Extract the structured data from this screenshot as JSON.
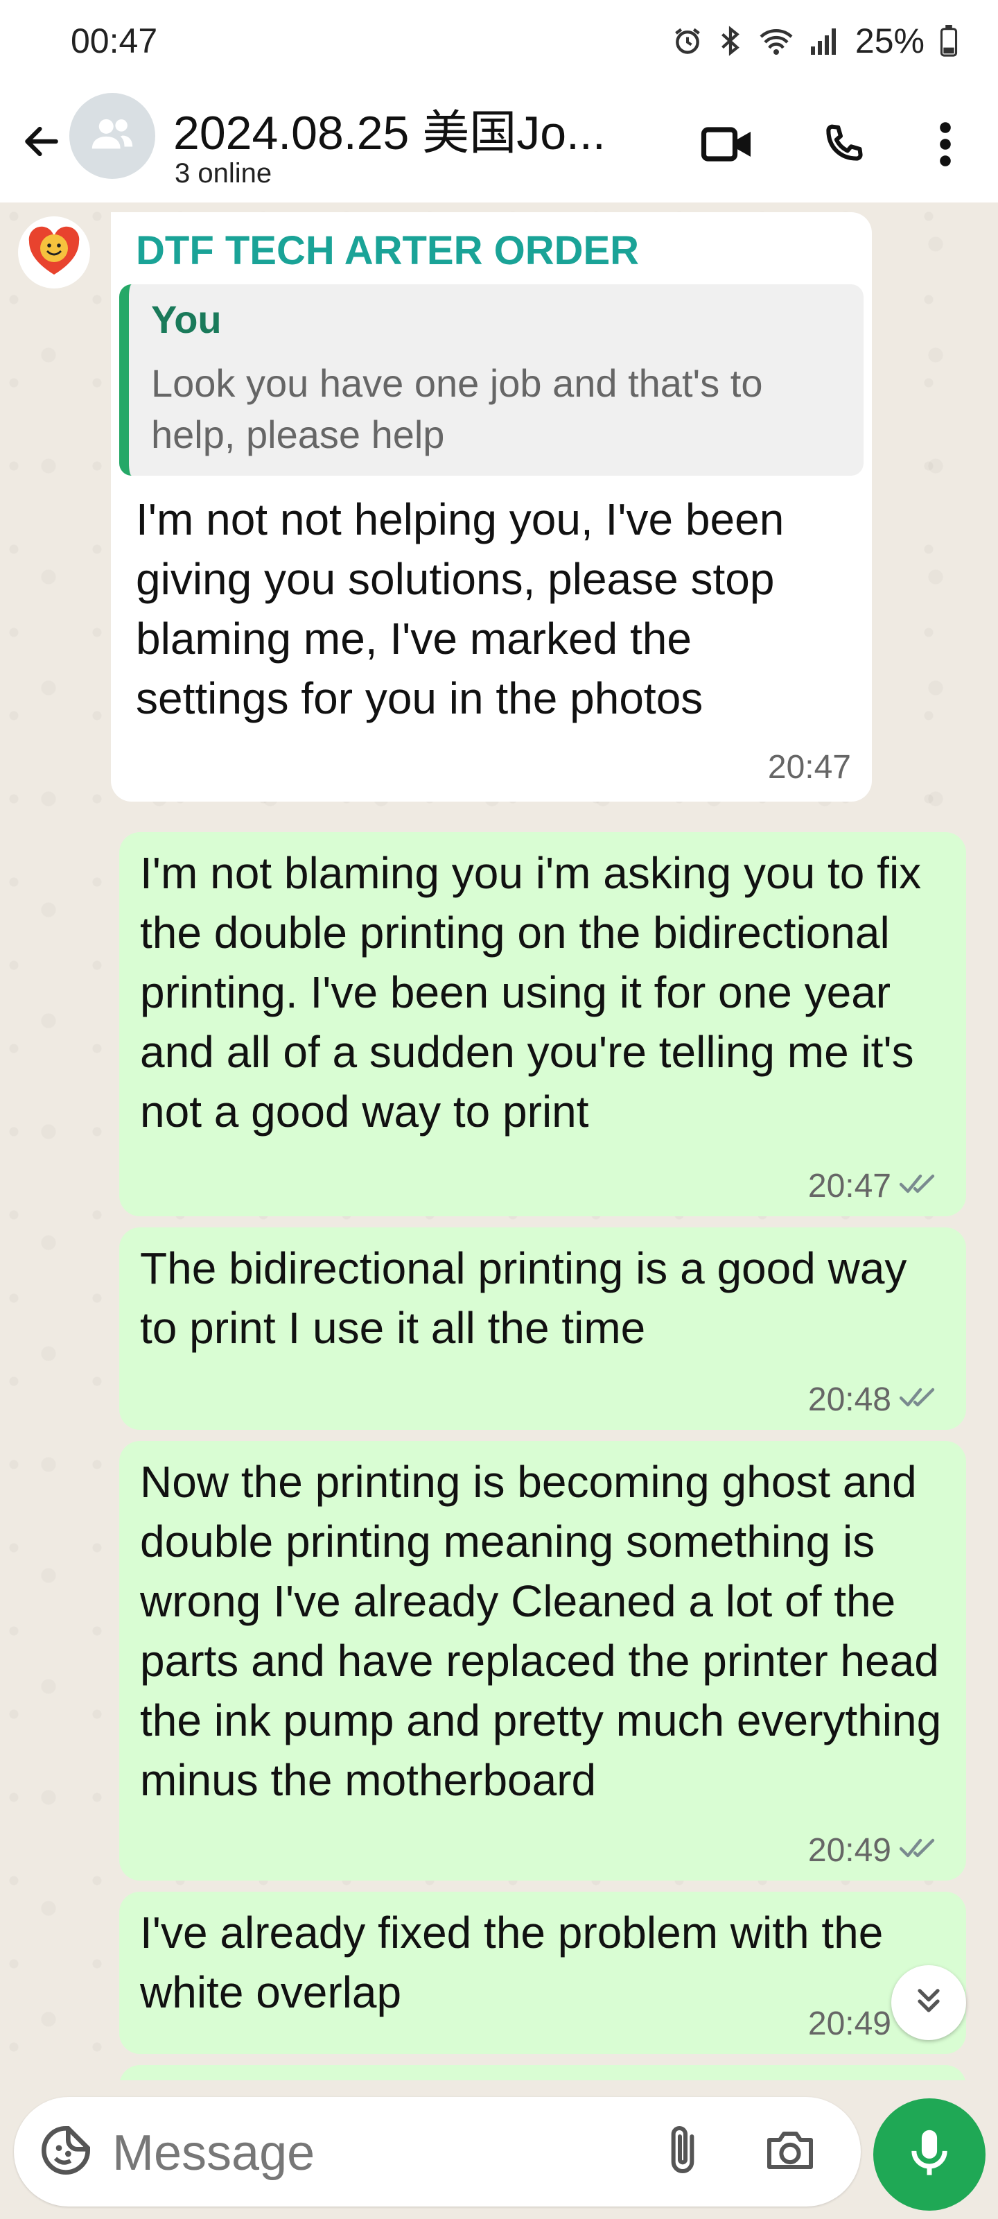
{
  "status_bar": {
    "time": "00:47",
    "battery": "25%",
    "icons": [
      "alarm-icon",
      "bluetooth-icon",
      "wifi-icon",
      "signal-icon",
      "battery-icon"
    ]
  },
  "header": {
    "title": "2024.08.25 美国Jo...",
    "subtitle": "3 online",
    "icons": [
      "back-arrow-icon",
      "group-avatar-icon",
      "video-call-icon",
      "phone-icon",
      "more-options-icon"
    ]
  },
  "messages": [
    {
      "direction": "incoming",
      "sender": "DTF TECH ARTER ORDER",
      "quote": {
        "author": "You",
        "text": "Look you have one job and that's to help, please help"
      },
      "text": "I'm not not helping you, I've been giving you solutions, please stop blaming me, I've marked the settings for you in the photos",
      "time": "20:47"
    },
    {
      "direction": "outgoing",
      "text": "I'm not blaming you i'm asking you to fix the double printing on the bidirectional printing. I've been using it for one year and all of a sudden you're telling me it's not a good way to print",
      "time": "20:47",
      "status": "read"
    },
    {
      "direction": "outgoing",
      "text": "The bidirectional printing is a good way to print I use it all the time",
      "time": "20:48",
      "status": "read"
    },
    {
      "direction": "outgoing",
      "text": "Now the printing is becoming ghost and double printing meaning something is wrong I've already Cleaned a lot of the parts and have replaced the printer head the ink pump and pretty much everything minus the motherboard",
      "time": "20:49",
      "status": "read"
    },
    {
      "direction": "outgoing",
      "text": "I've already fixed the problem with the white overlap",
      "time": "20:49",
      "status": "read"
    }
  ],
  "composer": {
    "placeholder": "Message",
    "icons": [
      "sticker-icon",
      "attach-icon",
      "camera-icon",
      "microphone-icon"
    ]
  },
  "colors": {
    "outgoing_bubble": "#d9fdd3",
    "incoming_bubble": "#ffffff",
    "sender_name": "#1aa397",
    "quote_bar": "#25a867",
    "read_ticks": "#7a8a8f",
    "mic_button": "#1fa855",
    "chat_background": "#efeae2"
  }
}
